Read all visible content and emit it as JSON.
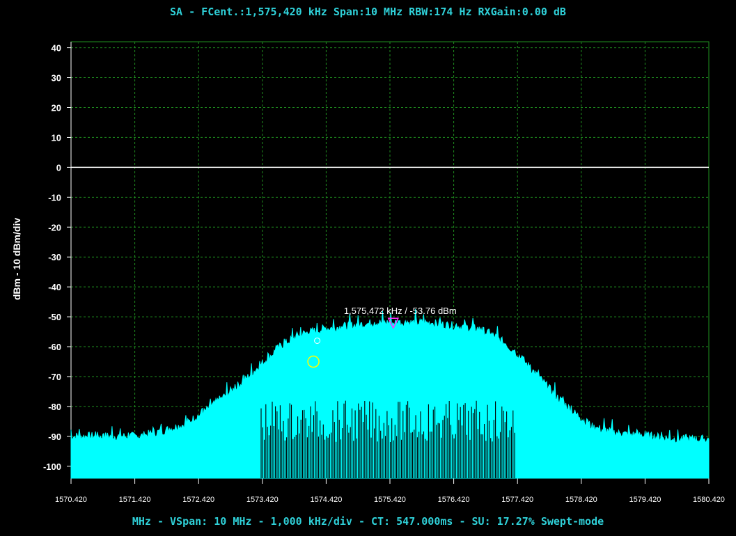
{
  "header": {
    "title": "SA - FCent.:1,575,420 kHz Span:10 MHz RBW:174 Hz RXGain:0.00 dB"
  },
  "footer": {
    "status": "MHz - VSpan: 10 MHz - 1,000 kHz/div - CT: 547.000ms - SU: 17.27% Swept-mode"
  },
  "colors": {
    "background": "#000000",
    "trace": "#00ffff",
    "grid": "#1f8f1f",
    "header_text": "#2fd0d8",
    "marker": "#ff33ff",
    "circle": "#ffff00",
    "reference_line": "#ffffff"
  },
  "chart_data": {
    "type": "area",
    "ylabel": "dBm - 10 dBm/div",
    "xlabel": "MHz",
    "xlim": [
      1570.42,
      1580.42
    ],
    "ylim": [
      -104,
      42
    ],
    "grid": true,
    "xticks": [
      "1570.420",
      "1571.420",
      "1572.420",
      "1573.420",
      "1574.420",
      "1575.420",
      "1576.420",
      "1577.420",
      "1578.420",
      "1579.420",
      "1580.420"
    ],
    "yticks": [
      "40",
      "30",
      "20",
      "10",
      "0",
      "-10",
      "-20",
      "-30",
      "-40",
      "-50",
      "-60",
      "-70",
      "-80",
      "-90",
      "-100"
    ],
    "reference_level": 0,
    "series": [
      {
        "x": [
          1570.42,
          1571.0,
          1571.5,
          1571.9,
          1572.2,
          1572.5,
          1572.8,
          1573.1,
          1573.4,
          1573.7,
          1574.0,
          1574.4,
          1574.8,
          1575.2,
          1575.42,
          1575.7,
          1576.0,
          1576.4,
          1576.8,
          1577.1,
          1577.4,
          1577.7,
          1578.0,
          1578.3,
          1578.6,
          1579.0,
          1579.5,
          1580.0,
          1580.42
        ],
        "values": [
          -90,
          -90,
          -90,
          -88,
          -86,
          -82,
          -77,
          -72,
          -66,
          -60,
          -56,
          -54,
          -53,
          -52,
          -52,
          -52,
          -52,
          -53,
          -54,
          -57,
          -62,
          -69,
          -76,
          -82,
          -87,
          -89,
          -90,
          -91,
          -91
        ]
      }
    ],
    "marker": {
      "x": 1575.472,
      "y": -53.76,
      "label": "1,575,472 kHz / -53.76 dBm"
    },
    "circle_marker": {
      "x": 1574.22,
      "y": -65
    },
    "small_marker": {
      "x": 1574.28,
      "y": -58
    }
  }
}
